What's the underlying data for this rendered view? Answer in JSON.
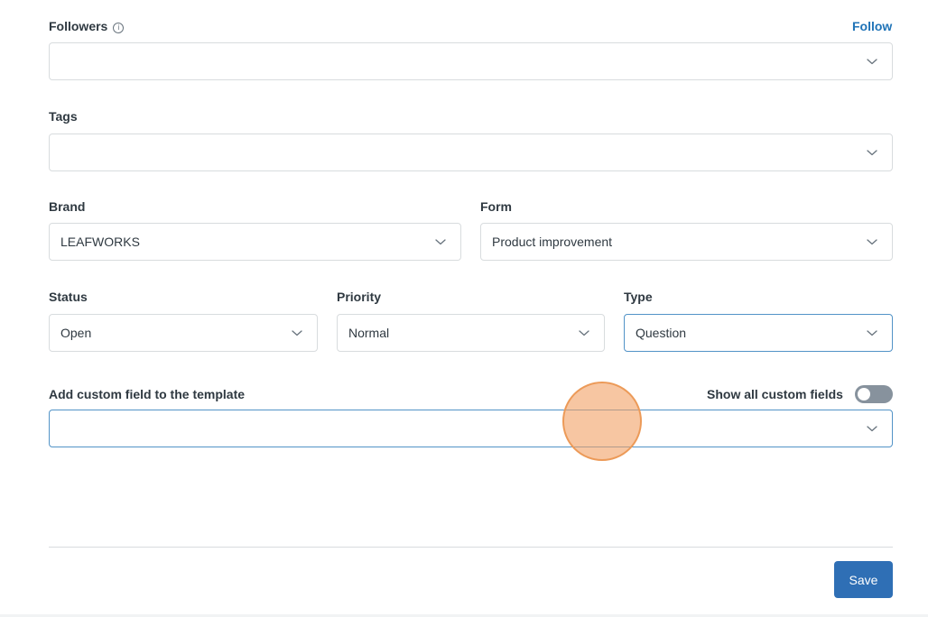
{
  "followers": {
    "label": "Followers",
    "info_icon": "info-icon",
    "info_glyph": "i",
    "follow_link": "Follow",
    "value": ""
  },
  "tags": {
    "label": "Tags",
    "value": ""
  },
  "brand": {
    "label": "Brand",
    "value": "LEAFWORKS"
  },
  "form": {
    "label": "Form",
    "value": "Product improvement"
  },
  "status": {
    "label": "Status",
    "value": "Open"
  },
  "priority": {
    "label": "Priority",
    "value": "Normal"
  },
  "type": {
    "label": "Type",
    "value": "Question"
  },
  "custom_field": {
    "label": "Add custom field to the template",
    "value": "",
    "show_all_label": "Show all custom fields",
    "show_all_enabled": false
  },
  "footer": {
    "save_label": "Save"
  },
  "icons": {
    "dropdown": "chevron-down-icon"
  },
  "colors": {
    "accent": "#1f73b7",
    "save_button": "#2f6fb5",
    "toggle_off": "#87929d",
    "focus_border": "#5293c7",
    "cursor_highlight": "#f2a064"
  }
}
